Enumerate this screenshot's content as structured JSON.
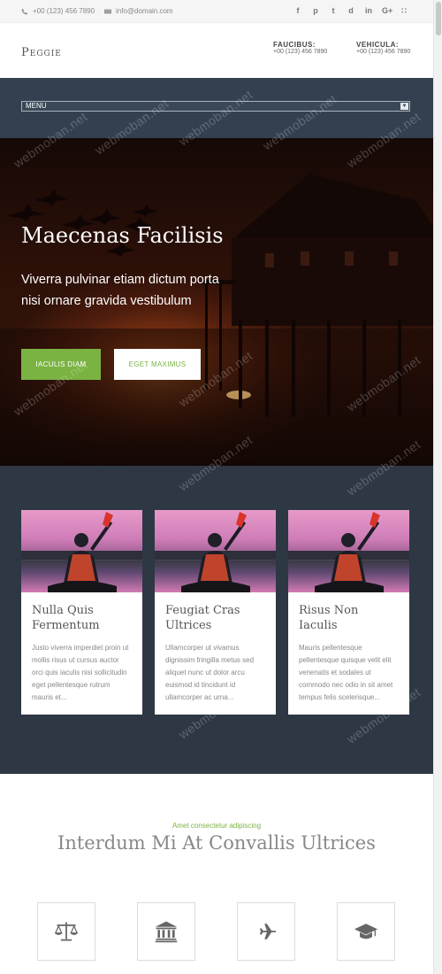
{
  "topbar": {
    "phone": "+00 (123) 456 7890",
    "email": "info@domain.com",
    "socials": [
      "f",
      "p",
      "t",
      "d",
      "in",
      "G+",
      "rss"
    ]
  },
  "header": {
    "logo": "Peggie",
    "info": [
      {
        "title": "FAUCIBUS:",
        "value": "+00 (123) 456 7890"
      },
      {
        "title": "VEHICULA:",
        "value": "+00 (123) 456 7890"
      }
    ]
  },
  "menu": {
    "label": "MENU"
  },
  "hero": {
    "title": "Maecenas Facilisis",
    "subtitle": "Viverra pulvinar etiam dictum porta nisi ornare gravida vestibulum",
    "btn_primary": "IACULIS DIAM",
    "btn_secondary": "EGET MAXIMUS"
  },
  "cards": [
    {
      "title": "Nulla Quis Fermentum",
      "text": "Justo viverra imperdiet proin ut mollis risus ut cursus auctor orci quis iaculis nisi sollicitudin eget pellentesque rutrum mauris et..."
    },
    {
      "title": "Feugiat Cras Ultrices",
      "text": "Ullamcorper ut vivamus dignissim fringilla metus sed aliquet nunc ut dolor arcu euismod id tincidunt id ullamcorper ac urna..."
    },
    {
      "title": "Risus Non Iaculis",
      "text": "Mauris pellentesque pellentesque quisque velit elit venenatis et sodales ut commodo nec odio in sit amet tempus felis scelerisque..."
    }
  ],
  "features": {
    "kicker": "Amet consectetur adipiscing",
    "title": "Interdum Mi At Convallis Ultrices",
    "icons": [
      "balance-scale-icon",
      "bank-icon",
      "plane-icon",
      "graduation-cap-icon"
    ]
  },
  "watermark": "webmoban.net",
  "colors": {
    "accent": "#7ab342",
    "dark": "#2e3744",
    "menubar": "#34404f"
  }
}
